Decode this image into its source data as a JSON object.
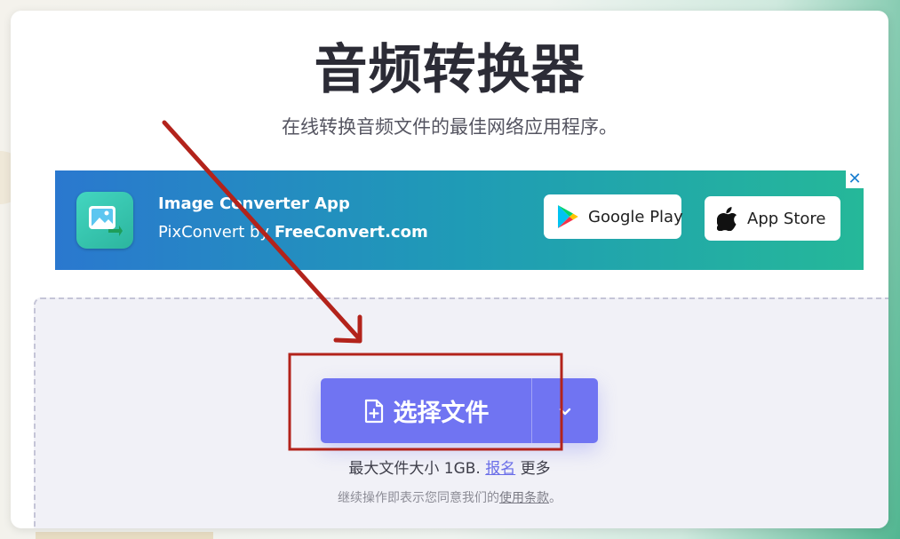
{
  "page": {
    "title": "音频转换器",
    "subtitle": "在线转换音频文件的最佳网络应用程序。"
  },
  "ad": {
    "close_label": "✕",
    "app_title": "Image Converter App",
    "app_sub_prefix": "PixConvert by ",
    "app_sub_brand": "FreeConvert.com",
    "google_play_label": "Google Play",
    "app_store_label": "App Store",
    "icon": "image-converter-app-icon"
  },
  "upload": {
    "choose_label": "选择文件",
    "choose_icon": "file-plus-icon",
    "dropdown_icon": "chevron-down-icon",
    "max_size_prefix": "最大文件大小 1GB. ",
    "signup_link": "报名",
    "max_size_suffix": " 更多",
    "terms_prefix": "继续操作即表示您同意我们的",
    "terms_link": "使用条款",
    "terms_suffix": "。"
  },
  "colors": {
    "accent": "#7074f2",
    "annotation": "#b3231b",
    "title": "#2c2c36"
  }
}
